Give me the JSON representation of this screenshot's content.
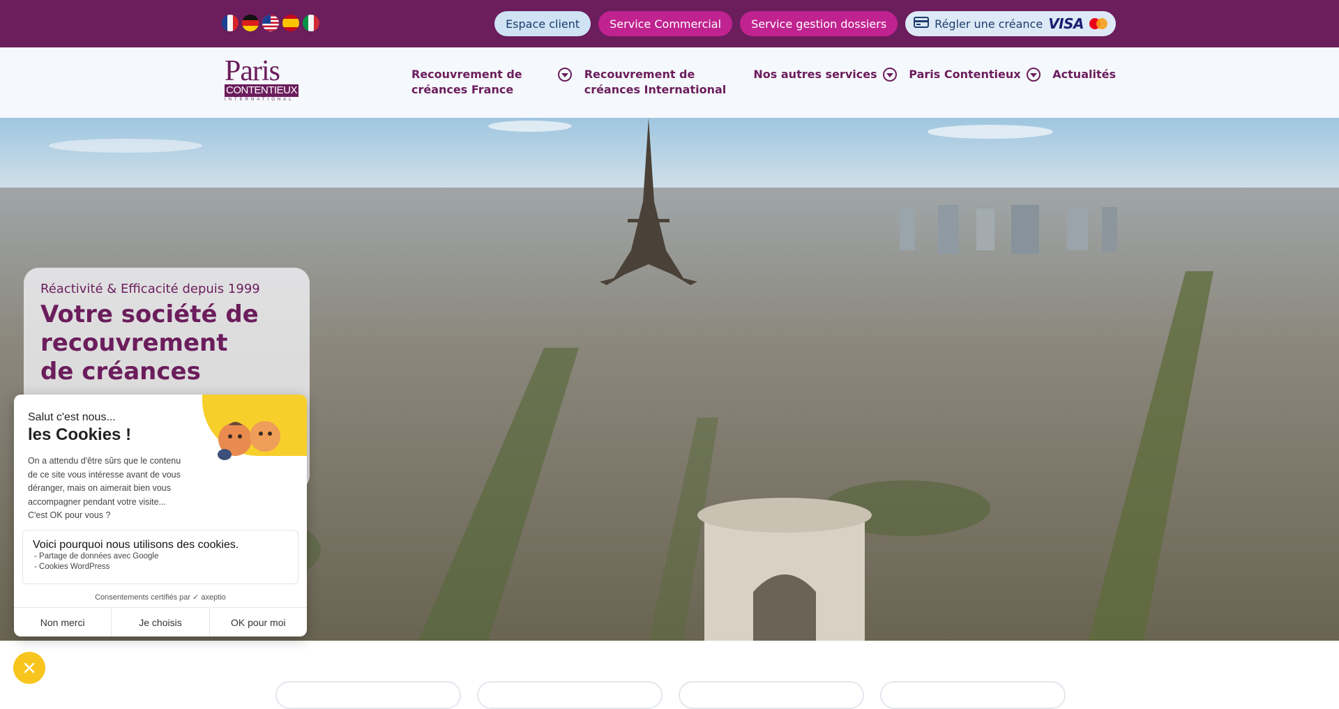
{
  "topbar": {
    "flags": [
      "Français",
      "Deutsch",
      "English (US)",
      "Español",
      "Italiano"
    ],
    "buttons": {
      "espace_client": "Espace client",
      "service_commercial": "Service Commercial",
      "service_dossiers": "Service gestion dossiers",
      "regler": "Régler une créance",
      "visa": "VISA"
    }
  },
  "header": {
    "logo": {
      "line1": "Paris",
      "line2": "CONTENTIEUX",
      "line3": "INTERNATIONAL"
    },
    "nav": [
      {
        "label": "Recouvrement de créances France",
        "has_dropdown": true
      },
      {
        "label": "Recouvrement de créances International",
        "has_dropdown": false
      },
      {
        "label": "Nos autres services",
        "has_dropdown": true
      },
      {
        "label": "Paris Contentieux",
        "has_dropdown": true
      },
      {
        "label": "Actualités",
        "has_dropdown": false
      }
    ]
  },
  "hero": {
    "kicker": "Réactivité & Efficacité depuis 1999",
    "title_line1": "Votre société de",
    "title_line2": "recouvrement",
    "title_line3": "de créances"
  },
  "cookie": {
    "greeting": "Salut c'est nous...",
    "title": "les Cookies !",
    "body": "On a attendu d'être sûrs que le contenu de ce site vous intéresse avant de vous déranger, mais on aimerait bien vous accompagner pendant votre visite...",
    "question": "C'est OK pour vous ?",
    "why_title": "Voici pourquoi nous utilisons des cookies.",
    "why_items": [
      "- Partage de données avec Google",
      "- Cookies WordPress"
    ],
    "certified": "Consentements certifiés par",
    "certified_brand": "axeptio",
    "buttons": {
      "no": "Non merci",
      "choose": "Je choisis",
      "ok": "OK pour moi"
    }
  },
  "colors": {
    "brand": "#6b1d5c",
    "magenta": "#c0238f",
    "accent_yellow": "#f7c51d",
    "light_blue": "#cfe3f5"
  }
}
